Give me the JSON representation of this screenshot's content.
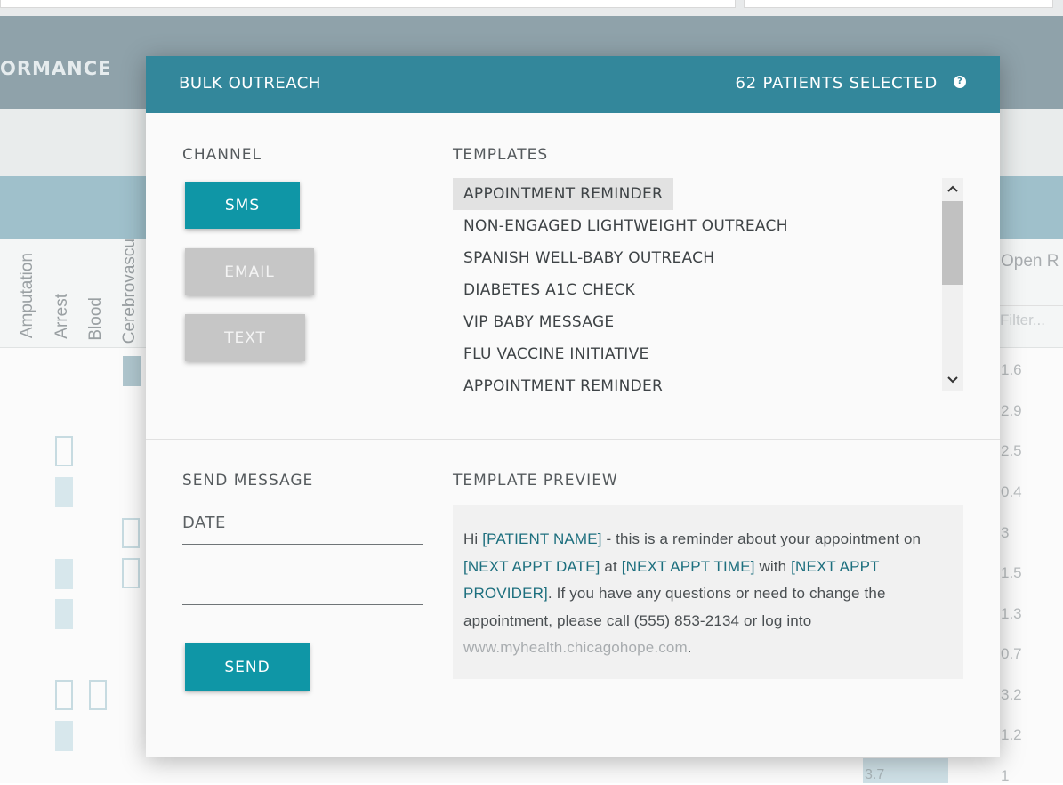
{
  "background": {
    "banner_title": "ORMANCE",
    "column_labels": [
      "Amputation",
      "Arrest",
      "Blood",
      "Cerebrovascu"
    ],
    "open_label": "Open R",
    "filter_placeholder": "Filter...",
    "row_values": [
      "1.6",
      "2.9",
      "2.5",
      "0.4",
      "3",
      "1.5",
      "1.3",
      "0.7",
      "3.2",
      "1.2",
      "1"
    ],
    "bottom_value": "3.7"
  },
  "modal": {
    "title": "BULK OUTREACH",
    "selected_count": "62 PATIENTS SELECTED",
    "help_icon": "?",
    "channel": {
      "label": "CHANNEL",
      "options": [
        {
          "label": "SMS",
          "active": true
        },
        {
          "label": "EMAIL",
          "active": false
        },
        {
          "label": "TEXT",
          "active": false
        }
      ]
    },
    "templates": {
      "label": "TEMPLATES",
      "items": [
        "APPOINTMENT REMINDER",
        "NON-ENGAGED LIGHTWEIGHT OUTREACH",
        "SPANISH WELL-BABY OUTREACH",
        "DIABETES A1C CHECK",
        "VIP BABY MESSAGE",
        "FLU VACCINE INITIATIVE",
        "APPOINTMENT REMINDER"
      ],
      "selected_index": 0,
      "scroll_up_icon": "chevron-up-icon",
      "scroll_down_icon": "chevron-down-icon"
    },
    "send_message": {
      "label": "SEND MESSAGE",
      "date_placeholder": "DATE",
      "second_field_value": "",
      "send_label": "SEND"
    },
    "preview": {
      "label": "TEMPLATE PREVIEW",
      "t1": "Hi ",
      "tok_patient": "[PATIENT NAME]",
      "t2": " - this is a reminder about your appointment on ",
      "tok_date": "[NEXT APPT DATE]",
      "t3": " at ",
      "tok_time": "[NEXT APPT TIME]",
      "t4": " with ",
      "tok_provider": "[NEXT APPT PROVIDER]",
      "t5": ". If you have any questions or need to change the appointment, please call (555) 853-2134 or log into ",
      "link": "www.myhealth.chicagohope.com",
      "t6": "."
    }
  },
  "colors": {
    "header": "#33879b",
    "primary_button": "#0f96a6",
    "disabled_button": "#c6c6c6",
    "token_text": "#1d6f7e"
  }
}
